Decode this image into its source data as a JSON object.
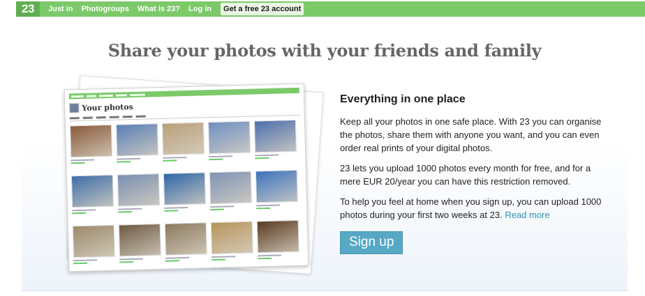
{
  "nav": {
    "logo": "23",
    "links": [
      "Just in",
      "Photogroups",
      "What is 23?",
      "Log in"
    ],
    "cta": "Get a free 23 account",
    "color_primary": "#7cc96a"
  },
  "main": {
    "headline": "Share your photos with your friends and family",
    "illustration": {
      "title": "Your photos",
      "thumb_colors": [
        "#8a5a3a",
        "#5a7fb5",
        "#b99f7a",
        "#6f8fc2",
        "#4d6fae",
        "#3f6ea8",
        "#7a8fb0",
        "#2f66a8",
        "#7f93b5",
        "#3b72c0",
        "#9c8a6a",
        "#6f5a44",
        "#8c7a5e",
        "#b8945c",
        "#5a3b20"
      ]
    },
    "section_title": "Everything in one place",
    "paragraphs": [
      "Keep all your photos in one safe place. With 23 you can organise the photos, share them with anyone you want, and you can even order real prints of your digital photos.",
      "23 lets you upload 1000 photos every month for free, and for a mere EUR 20/year you can have this restriction removed."
    ],
    "paragraph3": "To help you feel at home when you sign up, you can upload 1000 photos during your first two weeks at 23.",
    "read_more": "Read more",
    "signup_label": "Sign up",
    "link_color": "#2e8fb1",
    "button_color": "#56a8c5"
  }
}
